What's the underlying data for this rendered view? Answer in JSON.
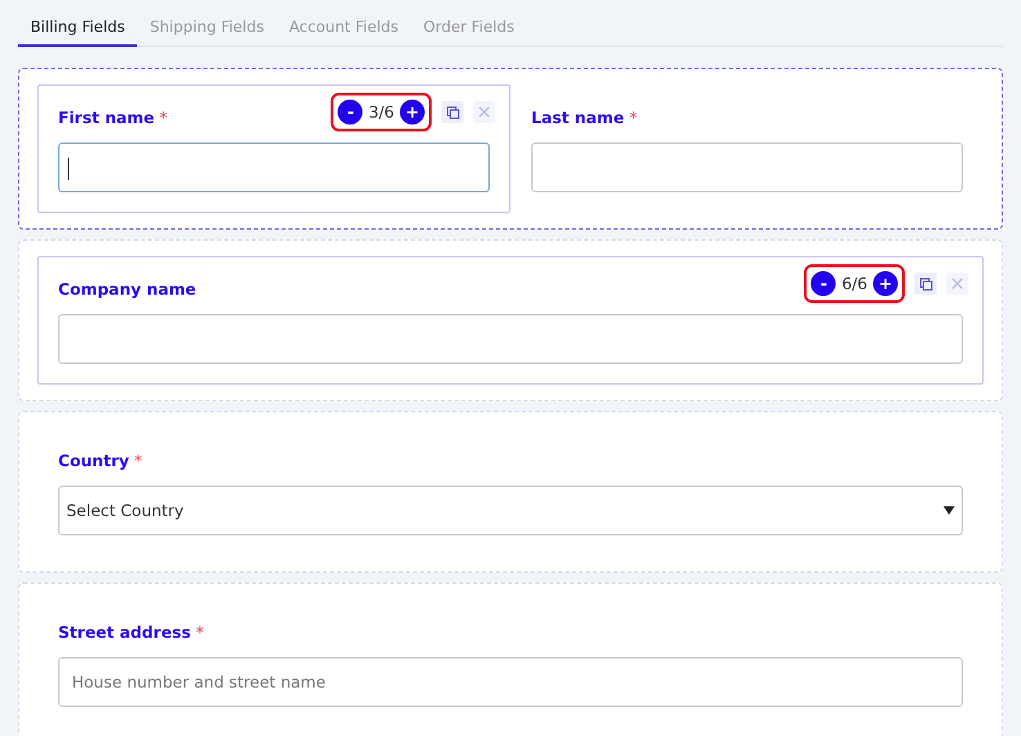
{
  "tabs": [
    {
      "label": "Billing Fields",
      "selected": true
    },
    {
      "label": "Shipping Fields",
      "selected": false
    },
    {
      "label": "Account Fields",
      "selected": false
    },
    {
      "label": "Order Fields",
      "selected": false
    }
  ],
  "rows": [
    {
      "selected": true,
      "fields": [
        {
          "kind": "text",
          "label": "First name",
          "required_mark": "*",
          "active": true,
          "focused": true,
          "width_control": {
            "minus": "-",
            "value": "3/6",
            "plus": "+",
            "highlighted": true
          }
        },
        {
          "kind": "text",
          "label": "Last name",
          "required_mark": "*",
          "active": false,
          "focused": false
        }
      ]
    },
    {
      "selected": false,
      "fields": [
        {
          "kind": "text",
          "label": "Company name",
          "active": true,
          "focused": false,
          "width_control": {
            "minus": "-",
            "value": "6/6",
            "plus": "+",
            "highlighted": true
          }
        }
      ]
    },
    {
      "selected": false,
      "fields": [
        {
          "kind": "select",
          "label": "Country",
          "required_mark": "*",
          "active": false,
          "value": "Select Country"
        }
      ]
    },
    {
      "selected": false,
      "fields": [
        {
          "kind": "text",
          "label": "Street address",
          "required_mark": "*",
          "active": false,
          "focused": false,
          "placeholder": "House number and street name"
        }
      ]
    }
  ]
}
